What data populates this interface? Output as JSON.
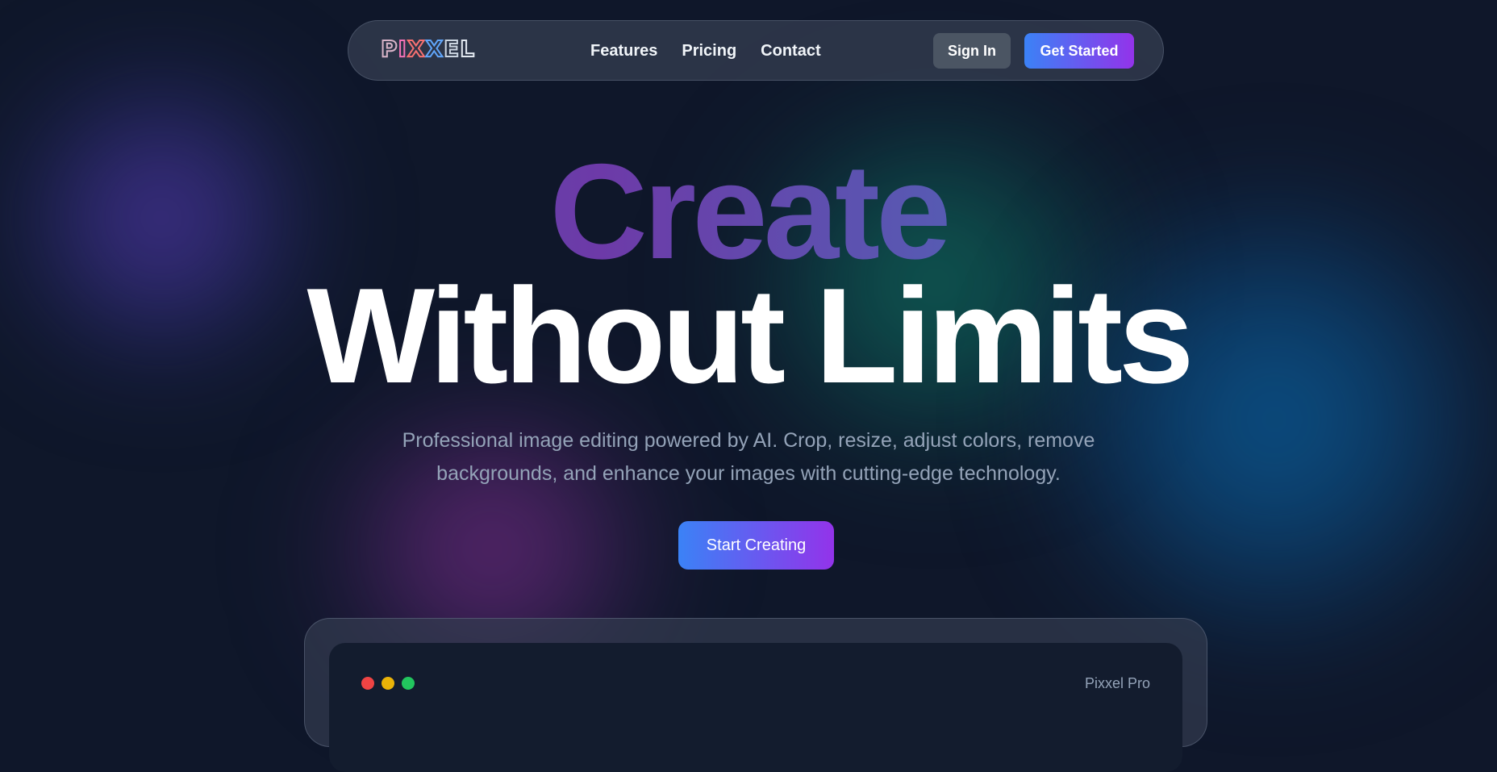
{
  "brand": {
    "logo_text": "PIXXEL"
  },
  "nav": {
    "links": [
      "Features",
      "Pricing",
      "Contact"
    ],
    "sign_in": "Sign In",
    "get_started": "Get Started"
  },
  "hero": {
    "title_line1": "Create",
    "title_line2": "Without Limits",
    "subtitle": "Professional image editing powered by AI. Crop, resize, adjust colors, remove backgrounds, and enhance your images with cutting-edge technology.",
    "cta": "Start Creating"
  },
  "preview": {
    "window_title": "Pixxel Pro",
    "traffic_lights": [
      "red",
      "yellow",
      "green"
    ]
  },
  "colors": {
    "background": "#0f172a",
    "accent_start": "#3b82f6",
    "accent_end": "#9333ea",
    "muted_text": "#94a3b8"
  }
}
